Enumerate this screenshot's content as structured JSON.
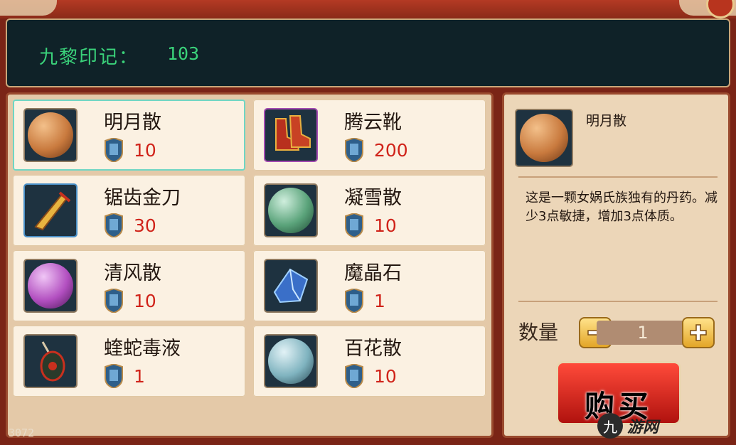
{
  "currency": {
    "label": "九黎印记：",
    "value": "103"
  },
  "items": [
    {
      "name": "明月散",
      "price": "10",
      "icon": "amber-orb-icon",
      "orb_color": "#c97a3e"
    },
    {
      "name": "腾云靴",
      "price": "200",
      "icon": "boots-icon"
    },
    {
      "name": "锯齿金刀",
      "price": "30",
      "icon": "golden-sword-icon"
    },
    {
      "name": "凝雪散",
      "price": "10",
      "icon": "green-orb-icon",
      "orb_color": "#5aa37a"
    },
    {
      "name": "清风散",
      "price": "10",
      "icon": "purple-orb-icon",
      "orb_color": "#b24fc0"
    },
    {
      "name": "魔晶石",
      "price": "1",
      "icon": "crystal-icon"
    },
    {
      "name": "蝰蛇毒液",
      "price": "1",
      "icon": "venom-pendant-icon"
    },
    {
      "name": "百花散",
      "price": "10",
      "icon": "teal-orb-icon",
      "orb_color": "#7fb3bf"
    }
  ],
  "detail": {
    "name": "明月散",
    "description": "这是一颗女娲氏族独有的丹药。减少3点敏捷，增加3点体质。",
    "quantity_label": "数量",
    "quantity": "1",
    "buy_label": "购买"
  },
  "corner_text": "3072",
  "watermark": {
    "logo": "九",
    "text": "游网"
  },
  "colors": {
    "price_red": "#d0231a",
    "currency_green": "#3ad27a",
    "selected_border": "#6fd6c4"
  }
}
